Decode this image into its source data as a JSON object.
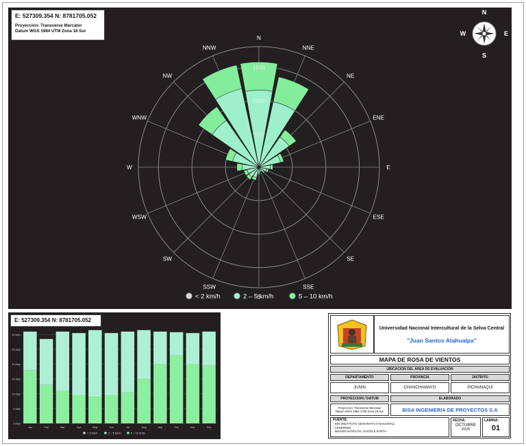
{
  "map_header": {
    "coords": "E: 527309.354 N: 8781705.052",
    "projection_line1": "Proyeccion: Transverse Mercator",
    "projection_line2": "Datum WGS 1984 UTM Zona 18 Sur"
  },
  "north_arrow": {
    "n": "N",
    "s": "S",
    "e": "E",
    "w": "W"
  },
  "chart_data": [
    {
      "type": "polar-bar",
      "directions": [
        "N",
        "NNE",
        "NE",
        "ENE",
        "E",
        "ESE",
        "SE",
        "SSE",
        "S",
        "SSW",
        "SW",
        "WSW",
        "W",
        "WNW",
        "NW",
        "NNW"
      ],
      "radial_ticks": [
        "500",
        "1000",
        "1500"
      ],
      "rmax": 1800,
      "series": [
        {
          "name": "< 2 km/h",
          "values": [
            60,
            45,
            30,
            20,
            20,
            15,
            15,
            15,
            20,
            30,
            25,
            15,
            10,
            15,
            25,
            50
          ],
          "color": "#d4d4d4"
        },
        {
          "name": "2 – 5 km/h",
          "values": [
            1150,
            1000,
            550,
            330,
            170,
            120,
            90,
            70,
            90,
            160,
            180,
            180,
            250,
            400,
            850,
            1200
          ],
          "color": "#9ef0cc"
        },
        {
          "name": "5 – 10 km/h",
          "values": [
            1570,
            1380,
            680,
            380,
            210,
            150,
            110,
            80,
            110,
            200,
            230,
            230,
            330,
            510,
            1100,
            1560
          ],
          "color": "#83ed9c"
        }
      ],
      "legend_position": "bottom"
    },
    {
      "type": "bar",
      "categories": [
        "Jan",
        "Feb",
        "Mar",
        "Apr",
        "May",
        "Jun",
        "Jul",
        "Aug",
        "Sep",
        "Oct",
        "Nov",
        "Dec"
      ],
      "y_tick_labels": [
        "0 days",
        "5 days",
        "10 days",
        "15 days",
        "20 days",
        "25 days",
        "30 days"
      ],
      "ylim": [
        0,
        31
      ],
      "series": [
        {
          "name": "< 2 km/h",
          "values": [
            0,
            0,
            0,
            0,
            0,
            0,
            0,
            0,
            0,
            0,
            0,
            0
          ],
          "color": "#d4d4d4"
        },
        {
          "name": "2 – 5 km/h",
          "values": [
            13,
            15.5,
            20,
            21,
            22.5,
            21,
            20.5,
            16.5,
            11,
            7.8,
            10.5,
            11.5
          ],
          "color": "#aef0d6"
        },
        {
          "name": "5 – 10 km/h",
          "values": [
            18,
            13,
            11,
            9.5,
            9,
            9.5,
            10.5,
            15,
            20,
            23,
            20,
            19.5
          ],
          "color": "#8cef9f"
        }
      ],
      "legend_position": "bottom"
    }
  ],
  "title_block": {
    "university_line": "Universidad Nacional Intercultural de la Selva Central",
    "university_name": "\"Juan Santos Atahualpa\"",
    "map_title": "MAPA DE ROSA DE VIENTOS",
    "location_header": "UBICACION DEL AREA DE EVALUACION",
    "department_label": "DEPARTAMENTO",
    "province_label": "PROVINCIA",
    "district_label": "DISTRITO",
    "department": "JUNIN",
    "province": "CHANCHAMAYO",
    "district": "PICHANAQUI",
    "projection_label": "PROYECCION / DATUM",
    "prepared_label": "ELABORADO",
    "projection_line1": "Proyeccion: Transverse Mercator",
    "projection_line2": "Datum WGS 1984 UTM Zona 18 Sur",
    "company": "BISA INGENIERIA DE PROYECTOS S.A",
    "source_label": "FUENTE:",
    "sources": [
      "- IGN (INSTITUTO GEOGRAFICO NACIONAL)",
      "- CENEPRED",
      "- IMAGEN SATELITAL GOOGLE EARTH"
    ],
    "date_label": "FECHA:",
    "date_month": "OCTUBRE",
    "date_year": "2025",
    "sheet_label": "LAMINA:",
    "sheet_number": "01"
  }
}
